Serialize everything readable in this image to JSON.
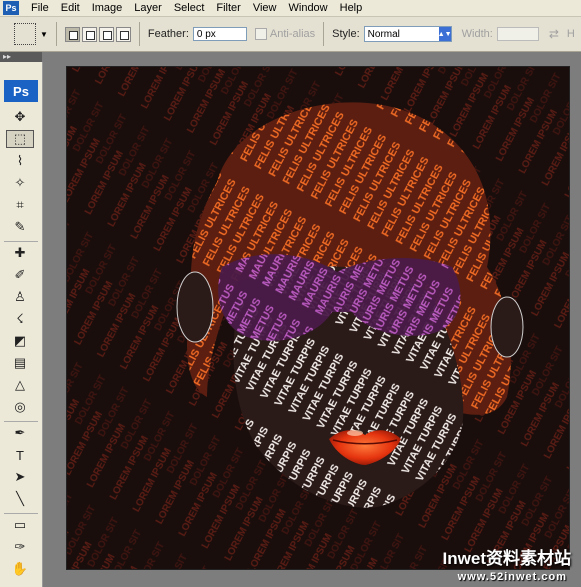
{
  "menu": {
    "app_icon": "Ps",
    "items": [
      "File",
      "Edit",
      "Image",
      "Layer",
      "Select",
      "Filter",
      "View",
      "Window",
      "Help"
    ]
  },
  "options": {
    "feather_label": "Feather:",
    "feather_value": "0 px",
    "antialias_label": "Anti-alias",
    "style_label": "Style:",
    "style_value": "Normal",
    "width_label": "Width:"
  },
  "toolbox": {
    "logo": "Ps",
    "tools": [
      {
        "name": "move-tool-icon",
        "glyph": "✥"
      },
      {
        "name": "marquee-tool-icon",
        "glyph": "⬚"
      },
      {
        "name": "lasso-tool-icon",
        "glyph": "⌇"
      },
      {
        "name": "magic-wand-tool-icon",
        "glyph": "✧"
      },
      {
        "name": "crop-tool-icon",
        "glyph": "⌗"
      },
      {
        "name": "slice-tool-icon",
        "glyph": "✎"
      },
      {
        "name": "healing-brush-tool-icon",
        "glyph": "✚"
      },
      {
        "name": "brush-tool-icon",
        "glyph": "✐"
      },
      {
        "name": "clone-stamp-tool-icon",
        "glyph": "♙"
      },
      {
        "name": "history-brush-tool-icon",
        "glyph": "☇"
      },
      {
        "name": "eraser-tool-icon",
        "glyph": "◩"
      },
      {
        "name": "gradient-tool-icon",
        "glyph": "▤"
      },
      {
        "name": "blur-tool-icon",
        "glyph": "△"
      },
      {
        "name": "dodge-tool-icon",
        "glyph": "◎"
      },
      {
        "name": "pen-tool-icon",
        "glyph": "✒"
      },
      {
        "name": "type-tool-icon",
        "glyph": "T"
      },
      {
        "name": "path-selection-tool-icon",
        "glyph": "➤"
      },
      {
        "name": "line-tool-icon",
        "glyph": "╲"
      },
      {
        "name": "notes-tool-icon",
        "glyph": "▭"
      },
      {
        "name": "eyedropper-tool-icon",
        "glyph": "✑"
      },
      {
        "name": "hand-tool-icon",
        "glyph": "✋"
      }
    ]
  },
  "canvas": {
    "background_color": "#1a0e0c",
    "hair_color": "#e2561c",
    "face_color": "#ffffff",
    "glasses_color": "#b148b8",
    "lips_color": "#e5340f",
    "background_text_color": "#4a1a14"
  },
  "watermark": {
    "brand": "Inwet资料素材站",
    "url": "www.52inwet.com"
  }
}
